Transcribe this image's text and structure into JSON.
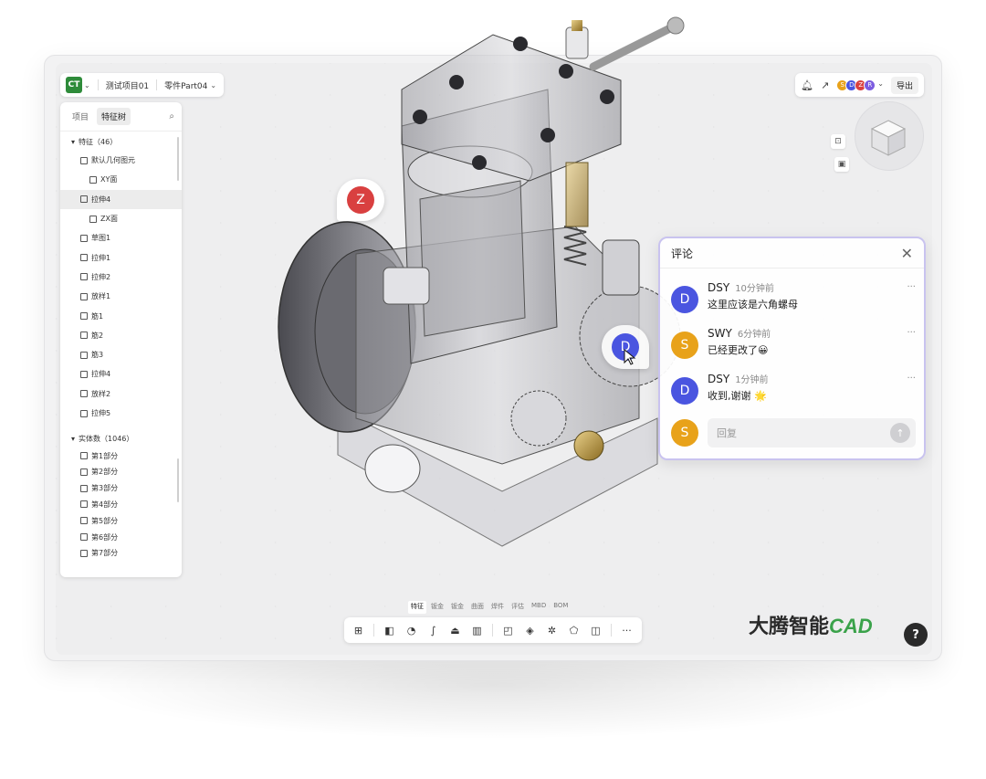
{
  "header": {
    "project": "测试项目01",
    "part": "零件Part04",
    "logo_text": "CT",
    "export_label": "导出",
    "collaborators": [
      {
        "initial": "S",
        "color": "#e8a21a"
      },
      {
        "initial": "D",
        "color": "#4a55e0"
      },
      {
        "initial": "Z",
        "color": "#d94040"
      },
      {
        "initial": "R",
        "color": "#7c5ce0"
      }
    ]
  },
  "sidebar": {
    "tabs": [
      "项目",
      "特征树"
    ],
    "features_group": "特征（46）",
    "features": [
      {
        "label": "默认几何图元",
        "child": false,
        "selected": false
      },
      {
        "label": "XY面",
        "child": true,
        "selected": false
      },
      {
        "label": "拉伸4",
        "child": false,
        "selected": true
      },
      {
        "label": "ZX面",
        "child": true,
        "selected": false
      },
      {
        "label": "草图1",
        "child": false,
        "selected": false
      },
      {
        "label": "拉伸1",
        "child": false,
        "selected": false
      },
      {
        "label": "拉伸2",
        "child": false,
        "selected": false
      },
      {
        "label": "放样1",
        "child": false,
        "selected": false
      },
      {
        "label": "筋1",
        "child": false,
        "selected": false
      },
      {
        "label": "筋2",
        "child": false,
        "selected": false
      },
      {
        "label": "筋3",
        "child": false,
        "selected": false
      },
      {
        "label": "拉伸4",
        "child": false,
        "selected": false
      },
      {
        "label": "放样2",
        "child": false,
        "selected": false
      },
      {
        "label": "拉伸5",
        "child": false,
        "selected": false
      }
    ],
    "bodies_group": "实体数（1046）",
    "bodies": [
      "第1部分",
      "第2部分",
      "第3部分",
      "第4部分",
      "第5部分",
      "第6部分",
      "第7部分"
    ]
  },
  "markers": {
    "z": "Z",
    "d": "D"
  },
  "comments": {
    "title": "评论",
    "items": [
      {
        "initial": "D",
        "name": "DSY",
        "time": "10分钟前",
        "text": "这里应该是六角螺母",
        "color": "#4a55e0"
      },
      {
        "initial": "S",
        "name": "SWY",
        "time": "6分钟前",
        "text": "已经更改了😀",
        "color": "#e8a21a"
      },
      {
        "initial": "D",
        "name": "DSY",
        "time": "1分钟前",
        "text": "收到,谢谢 🌟",
        "color": "#4a55e0"
      }
    ],
    "reply_avatar": "S",
    "reply_placeholder": "回复"
  },
  "mode_tabs": [
    "特征",
    "钣金",
    "钣金",
    "曲面",
    "焊件",
    "评估",
    "MBD",
    "BOM"
  ],
  "brand": {
    "text": "大腾智能",
    "cad": "CAD"
  },
  "help_label": "?"
}
